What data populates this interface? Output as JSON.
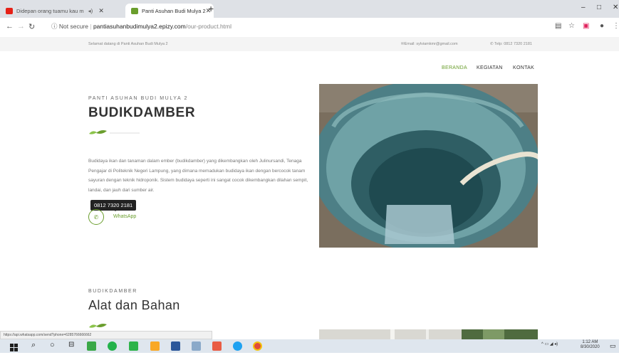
{
  "browser": {
    "tabs": [
      {
        "label": "Didepan orang tuamu kau m",
        "favicon_color": "#e62117",
        "active": false
      },
      {
        "label": "Panti Asuhan Budi Mulya 2",
        "favicon_color": "#6a9e2d",
        "active": true
      }
    ],
    "security": "Not secure",
    "url_host": "pantiasuhanbudimulya2.epizy.com",
    "url_path": "/our-product.html"
  },
  "site": {
    "welcome": "Selamat datang di Panti Asuhan Budi Mulya 2",
    "email": "Email: sylviamkmr@gmail.com",
    "phone": "Telp: 0812 7320 2181",
    "nav": [
      "BERANDA",
      "KEGIATAN",
      "KONTAK"
    ],
    "accent": "#6a9e2d"
  },
  "section1": {
    "eyebrow": "PANTI ASUHAN BUDI MULYA 2",
    "title": "BUDIKDAMBER",
    "paragraph": "Budidaya ikan dan tanaman dalam ember (budikdamber) yang dikembangkan oleh Julinursandi, Tenaga Pengajar di Politeknik Negeri Lampung, yang dimana memadukan budidaya ikan dengan bercocok tanam sayuran dengan teknik hidroponik. Sistem budidaya seperti ini sangat cocok dikembangkan dilahan sempit, landai, dan jauh dari sumber air.",
    "tooltip": "0812 7320 2181",
    "whatsapp_label": "WhatsApp"
  },
  "section2": {
    "eyebrow": "BUDIKDAMBER",
    "title": "Alat dan Bahan"
  },
  "status_url": "https://api.whatsapp.com/send?phone=6285766666662",
  "clock": {
    "time": "1:12 AM",
    "date": "8/30/2020"
  }
}
